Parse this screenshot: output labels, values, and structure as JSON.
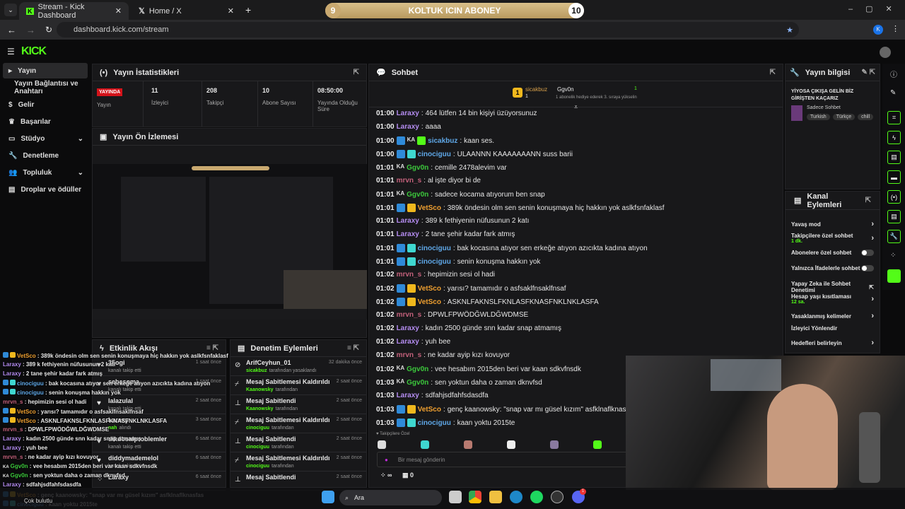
{
  "browser": {
    "tabs": [
      {
        "title": "Stream - Kick Dashboard"
      },
      {
        "title": "Home / X"
      }
    ],
    "url": "dashboard.kick.com/stream",
    "profile_initial": "K"
  },
  "goal": {
    "current": "9",
    "label": "KOLTUK ICIN ABONEY",
    "target": "10",
    "progress": 0.9
  },
  "sidebar": {
    "logo": "KICK",
    "items": [
      {
        "label": "Yayın"
      },
      {
        "label": "Yayın Bağlantısı ve Anahtarı"
      },
      {
        "label": "Gelir"
      },
      {
        "label": "Başarılar"
      },
      {
        "label": "Stüdyo"
      },
      {
        "label": "Denetleme"
      },
      {
        "label": "Topluluk"
      },
      {
        "label": "Droplar ve ödüller"
      }
    ]
  },
  "stats": {
    "title": "Yayın İstatistikleri",
    "live": "YAYINDA",
    "live_label": "Yayın",
    "items": [
      {
        "value": "11",
        "label": "İzleyici"
      },
      {
        "value": "208",
        "label": "Takipçi"
      },
      {
        "value": "10",
        "label": "Abone Sayısı"
      },
      {
        "value": "08:50:00",
        "label": "Yayında Olduğu Süre"
      }
    ]
  },
  "preview": {
    "title": "Yayın Ön İzlemesi"
  },
  "chat": {
    "title": "Sohbet",
    "top_gifter": {
      "rank": "1",
      "name": "sicakbuz",
      "count": "1"
    },
    "second": {
      "name": "Ggv0n",
      "count": "1",
      "hint": "1 abonelik hediye ederek 3. sıraya yükselin"
    },
    "messages": [
      {
        "time": "01:00",
        "badges": [],
        "user": "Laraxy",
        "color": "#b48cf0",
        "text": "464 lütfen 14 bin kişiyi üzüyorsunuz"
      },
      {
        "time": "01:00",
        "badges": [],
        "user": "Laraxy",
        "color": "#b48cf0",
        "text": "aaaa"
      },
      {
        "time": "01:00",
        "badges": [
          "blue",
          "KA",
          "green"
        ],
        "user": "sicakbuz",
        "color": "#5fa8e8",
        "text": "kaan ses."
      },
      {
        "time": "01:00",
        "badges": [
          "blue",
          "teal"
        ],
        "user": "cinociguu",
        "color": "#5fa8e8",
        "text": "ULAANNN KAAAAAAANN suss barii"
      },
      {
        "time": "01:01",
        "badges": [
          "KA"
        ],
        "user": "Ggv0n",
        "color": "#3cc83c",
        "text": "cemille 2478alevim var"
      },
      {
        "time": "01:01",
        "badges": [],
        "user": "mrvn_s",
        "color": "#c2607a",
        "text": "al işte diyor bi de"
      },
      {
        "time": "01:01",
        "badges": [
          "KA"
        ],
        "user": "Ggv0n",
        "color": "#3cc83c",
        "text": "sadece kocama atıyorum ben snap"
      },
      {
        "time": "01:01",
        "badges": [
          "blue",
          "gold"
        ],
        "user": "VetSco",
        "color": "#f0a030",
        "text": "389k öndesin olm sen senin konuşmaya hiç hakkın yok aslkfsnfaklasf"
      },
      {
        "time": "01:01",
        "badges": [],
        "user": "Laraxy",
        "color": "#b48cf0",
        "text": "389 k fethiyenin nüfusunun 2 katı"
      },
      {
        "time": "01:01",
        "badges": [],
        "user": "Laraxy",
        "color": "#b48cf0",
        "text": "2 tane şehir kadar fark atmış"
      },
      {
        "time": "01:01",
        "badges": [
          "blue",
          "teal"
        ],
        "user": "cinociguu",
        "color": "#5fa8e8",
        "text": "bak kocasına atıyor sen erkeğe atıyon azıcıkta kadına atıyon"
      },
      {
        "time": "01:01",
        "badges": [
          "blue",
          "teal"
        ],
        "user": "cinociguu",
        "color": "#5fa8e8",
        "text": "senin konuşma hakkın yok"
      },
      {
        "time": "01:02",
        "badges": [],
        "user": "mrvn_s",
        "color": "#c2607a",
        "text": "hepimizin sesi ol hadi"
      },
      {
        "time": "01:02",
        "badges": [
          "blue",
          "gold"
        ],
        "user": "VetSco",
        "color": "#f0a030",
        "text": "yarısı? tamamıdır o asfsaklfnsaklfnsaf"
      },
      {
        "time": "01:02",
        "badges": [
          "blue",
          "gold"
        ],
        "user": "VetSco",
        "color": "#f0a030",
        "text": "ASKNLFAKNSLFKNLASFKNASFNKLNKLASFA"
      },
      {
        "time": "01:02",
        "badges": [],
        "user": "mrvn_s",
        "color": "#c2607a",
        "text": "DPWLFPWÖDĞWLDĞWDMSE"
      },
      {
        "time": "01:02",
        "badges": [],
        "user": "Laraxy",
        "color": "#b48cf0",
        "text": "kadın 2500 günde snn kadar snap atmamış"
      },
      {
        "time": "01:02",
        "badges": [],
        "user": "Laraxy",
        "color": "#b48cf0",
        "text": "yuh bee"
      },
      {
        "time": "01:02",
        "badges": [],
        "user": "mrvn_s",
        "color": "#c2607a",
        "text": "ne kadar ayip kızı kovuyor"
      },
      {
        "time": "01:02",
        "badges": [
          "KA"
        ],
        "user": "Ggv0n",
        "color": "#3cc83c",
        "text": "vee hesabım 2015den beri var kaan sdkvfnsdk"
      },
      {
        "time": "01:03",
        "badges": [
          "KA"
        ],
        "user": "Ggv0n",
        "color": "#3cc83c",
        "text": "sen yoktun daha o zaman dknvfsd"
      },
      {
        "time": "01:03",
        "badges": [],
        "user": "Laraxy",
        "color": "#b48cf0",
        "text": "sdfahjsdfahfsdasdfa"
      },
      {
        "time": "01:03",
        "badges": [
          "blue",
          "gold"
        ],
        "user": "VetSco",
        "color": "#f0a030",
        "text": "genç kaanowsky: \"snap var mı güsel kızım\" asfklnaflknasfas"
      },
      {
        "time": "01:03",
        "badges": [
          "blue",
          "teal"
        ],
        "user": "cinociguu",
        "color": "#5fa8e8",
        "text": "kaan yoktu 2015te"
      }
    ],
    "followers_only": "Takipçilere Özel",
    "placeholder": "Bir mesaj gönderin",
    "points": "∞",
    "store_count": "0"
  },
  "activity": {
    "title": "Etkinlik Akışı",
    "items": [
      {
        "icon": "heart",
        "name": "35ogi",
        "sub": "kanalı takip etti",
        "when": "1 saat önce"
      },
      {
        "icon": "heart",
        "name": "sebasoma",
        "sub": "kanalı takip etti",
        "when": "1 saat önce"
      },
      {
        "icon": "heart",
        "name": "lalazulal",
        "sub": "kanalı takip etti",
        "when": "2 saat önce"
      },
      {
        "icon": "points",
        "name": "Laraxy",
        "sub_hl": "nah",
        "sub": "alındı",
        "when": "3 saat önce"
      },
      {
        "icon": "heart",
        "name": "dikdosalproblemler",
        "sub": "kanalı takip etti",
        "when": "6 saat önce"
      },
      {
        "icon": "heart",
        "name": "diddymademelol",
        "sub": "kanalı takip etti",
        "when": "6 saat önce"
      },
      {
        "icon": "points",
        "name": "Laraxy",
        "sub": "",
        "when": "6 saat önce"
      }
    ]
  },
  "moderation": {
    "title": "Denetim Eylemleri",
    "items": [
      {
        "icon": "ban",
        "name": "ArifCeyhun_01",
        "sub_hl": "sicakbuz",
        "sub": "tarafından yasaklandı",
        "when": "32 dakika önce"
      },
      {
        "icon": "unpin",
        "name": "Mesaj Sabitlemesi Kaldırıldı",
        "sub_hl": "Kaanowsky",
        "sub": "tarafından",
        "when": "2 saat önce"
      },
      {
        "icon": "pin",
        "name": "Mesaj Sabitlendi",
        "sub_hl": "Kaanowsky",
        "sub": "tarafından",
        "when": "2 saat önce"
      },
      {
        "icon": "unpin",
        "name": "Mesaj Sabitlemesi Kaldırıldı",
        "sub_hl": "cinociguu",
        "sub": "tarafından",
        "when": "2 saat önce"
      },
      {
        "icon": "pin",
        "name": "Mesaj Sabitlendi",
        "sub_hl": "cinociguu",
        "sub": "tarafından",
        "when": "2 saat önce"
      },
      {
        "icon": "unpin",
        "name": "Mesaj Sabitlemesi Kaldırıldı",
        "sub_hl": "cinociguu",
        "sub": "tarafından",
        "when": "2 saat önce"
      },
      {
        "icon": "pin",
        "name": "Mesaj Sabitlendi",
        "sub_hl": "",
        "sub": "",
        "when": "2 saat önce"
      }
    ]
  },
  "stream_info": {
    "title": "Yayın bilgisi",
    "stream_title": "YİYOSA ÇIKIŞA GELİN BİZ GİRİŞTEN KAÇARIZ",
    "category": "Sadece Sohbet",
    "tags": [
      "Turkish",
      "Türkçe",
      "chill"
    ]
  },
  "channel_actions": {
    "title": "Kanal Eylemleri",
    "items": [
      {
        "label": "Yavaş mod",
        "type": "arrow"
      },
      {
        "label": "Takipçilere özel sohbet",
        "sub": "1 dk.",
        "type": "arrow"
      },
      {
        "label": "Abonelere özel sohbet",
        "type": "toggle",
        "on": false
      },
      {
        "label": "Yalnızca İfadelerle sohbet",
        "type": "toggle",
        "on": false
      },
      {
        "label": "Yapay Zeka ile Sohbet Denetimi",
        "type": "ext"
      },
      {
        "label": "Hesap yaşı kısıtlaması",
        "sub": "12 sa.",
        "type": "arrow"
      },
      {
        "label": "Yasaklanmış kelimeler",
        "type": "arrow"
      },
      {
        "label": "İzleyici Yönlendir",
        "type": "none"
      },
      {
        "label": "Hedefleri belirleyin",
        "type": "arrow"
      }
    ]
  },
  "overlay": {
    "weather": "Çok bulutlu"
  },
  "taskbar": {
    "search": "Ara",
    "discord_badge": "1"
  }
}
